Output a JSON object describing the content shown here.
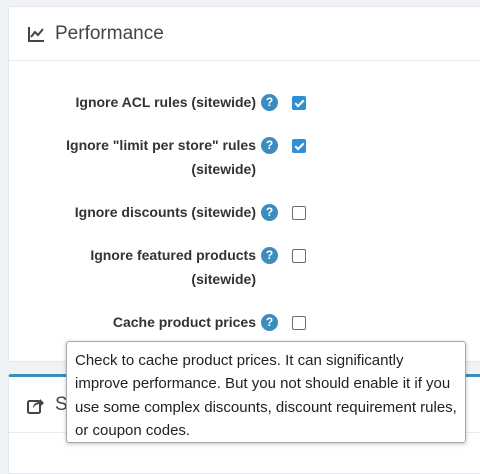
{
  "performance": {
    "title": "Performance",
    "icon": "line-chart-icon",
    "settings": [
      {
        "label": "Ignore ACL rules (sitewide)",
        "checked": true
      },
      {
        "label": "Ignore \"limit per store\" rules (sitewide)",
        "checked": true
      },
      {
        "label": "Ignore discounts (sitewide)",
        "checked": false
      },
      {
        "label": "Ignore featured products (sitewide)",
        "checked": false
      },
      {
        "label": "Cache product prices",
        "checked": false
      }
    ]
  },
  "second_section": {
    "title_partial": "S",
    "icon": "share-icon"
  },
  "help_glyph": "?",
  "tooltip": {
    "text": "Check to cache product prices. It can significantly improve performance. But you not should enable it if you use some complex discounts, discount requirement rules, or coupon codes."
  },
  "colors": {
    "accent": "#3c8dbc",
    "checkbox_checked": "#2f8fd6"
  }
}
